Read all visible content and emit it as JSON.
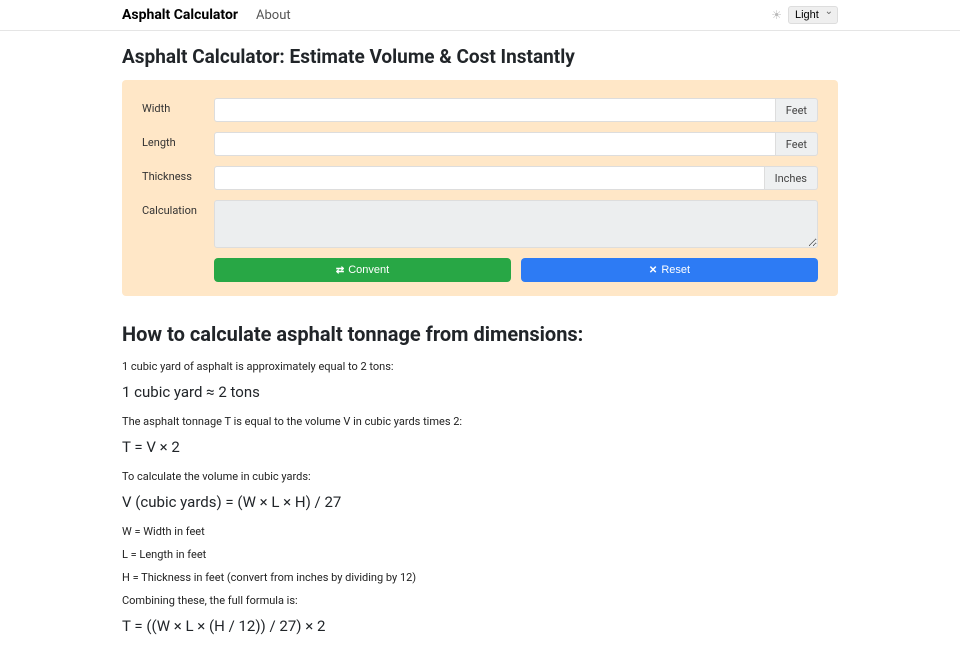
{
  "nav": {
    "brand": "Asphalt Calculator",
    "about": "About",
    "theme_selected": "Light"
  },
  "page": {
    "title": "Asphalt Calculator: Estimate Volume & Cost Instantly"
  },
  "form": {
    "width_label": "Width",
    "width_unit": "Feet",
    "length_label": "Length",
    "length_unit": "Feet",
    "thickness_label": "Thickness",
    "thickness_unit": "Inches",
    "calculation_label": "Calculation",
    "convert_btn": "Convent",
    "reset_btn": "Reset"
  },
  "howto": {
    "heading": "How to calculate asphalt tonnage from dimensions:",
    "p1": "1 cubic yard of asphalt is approximately equal to 2 tons:",
    "f1": "1 cubic yard ≈ 2 tons",
    "p2": "The asphalt tonnage T is equal to the volume V in cubic yards times 2:",
    "f2": "T = V × 2",
    "p3": "To calculate the volume in cubic yards:",
    "f3": "V (cubic yards) = (W × L × H) / 27",
    "p4": "W = Width in feet",
    "p5": "L = Length in feet",
    "p6": "H = Thickness in feet (convert from inches by dividing by 12)",
    "p7": "Combining these, the full formula is:",
    "f4": "T = ((W × L × (H / 12)) / 27) × 2"
  }
}
